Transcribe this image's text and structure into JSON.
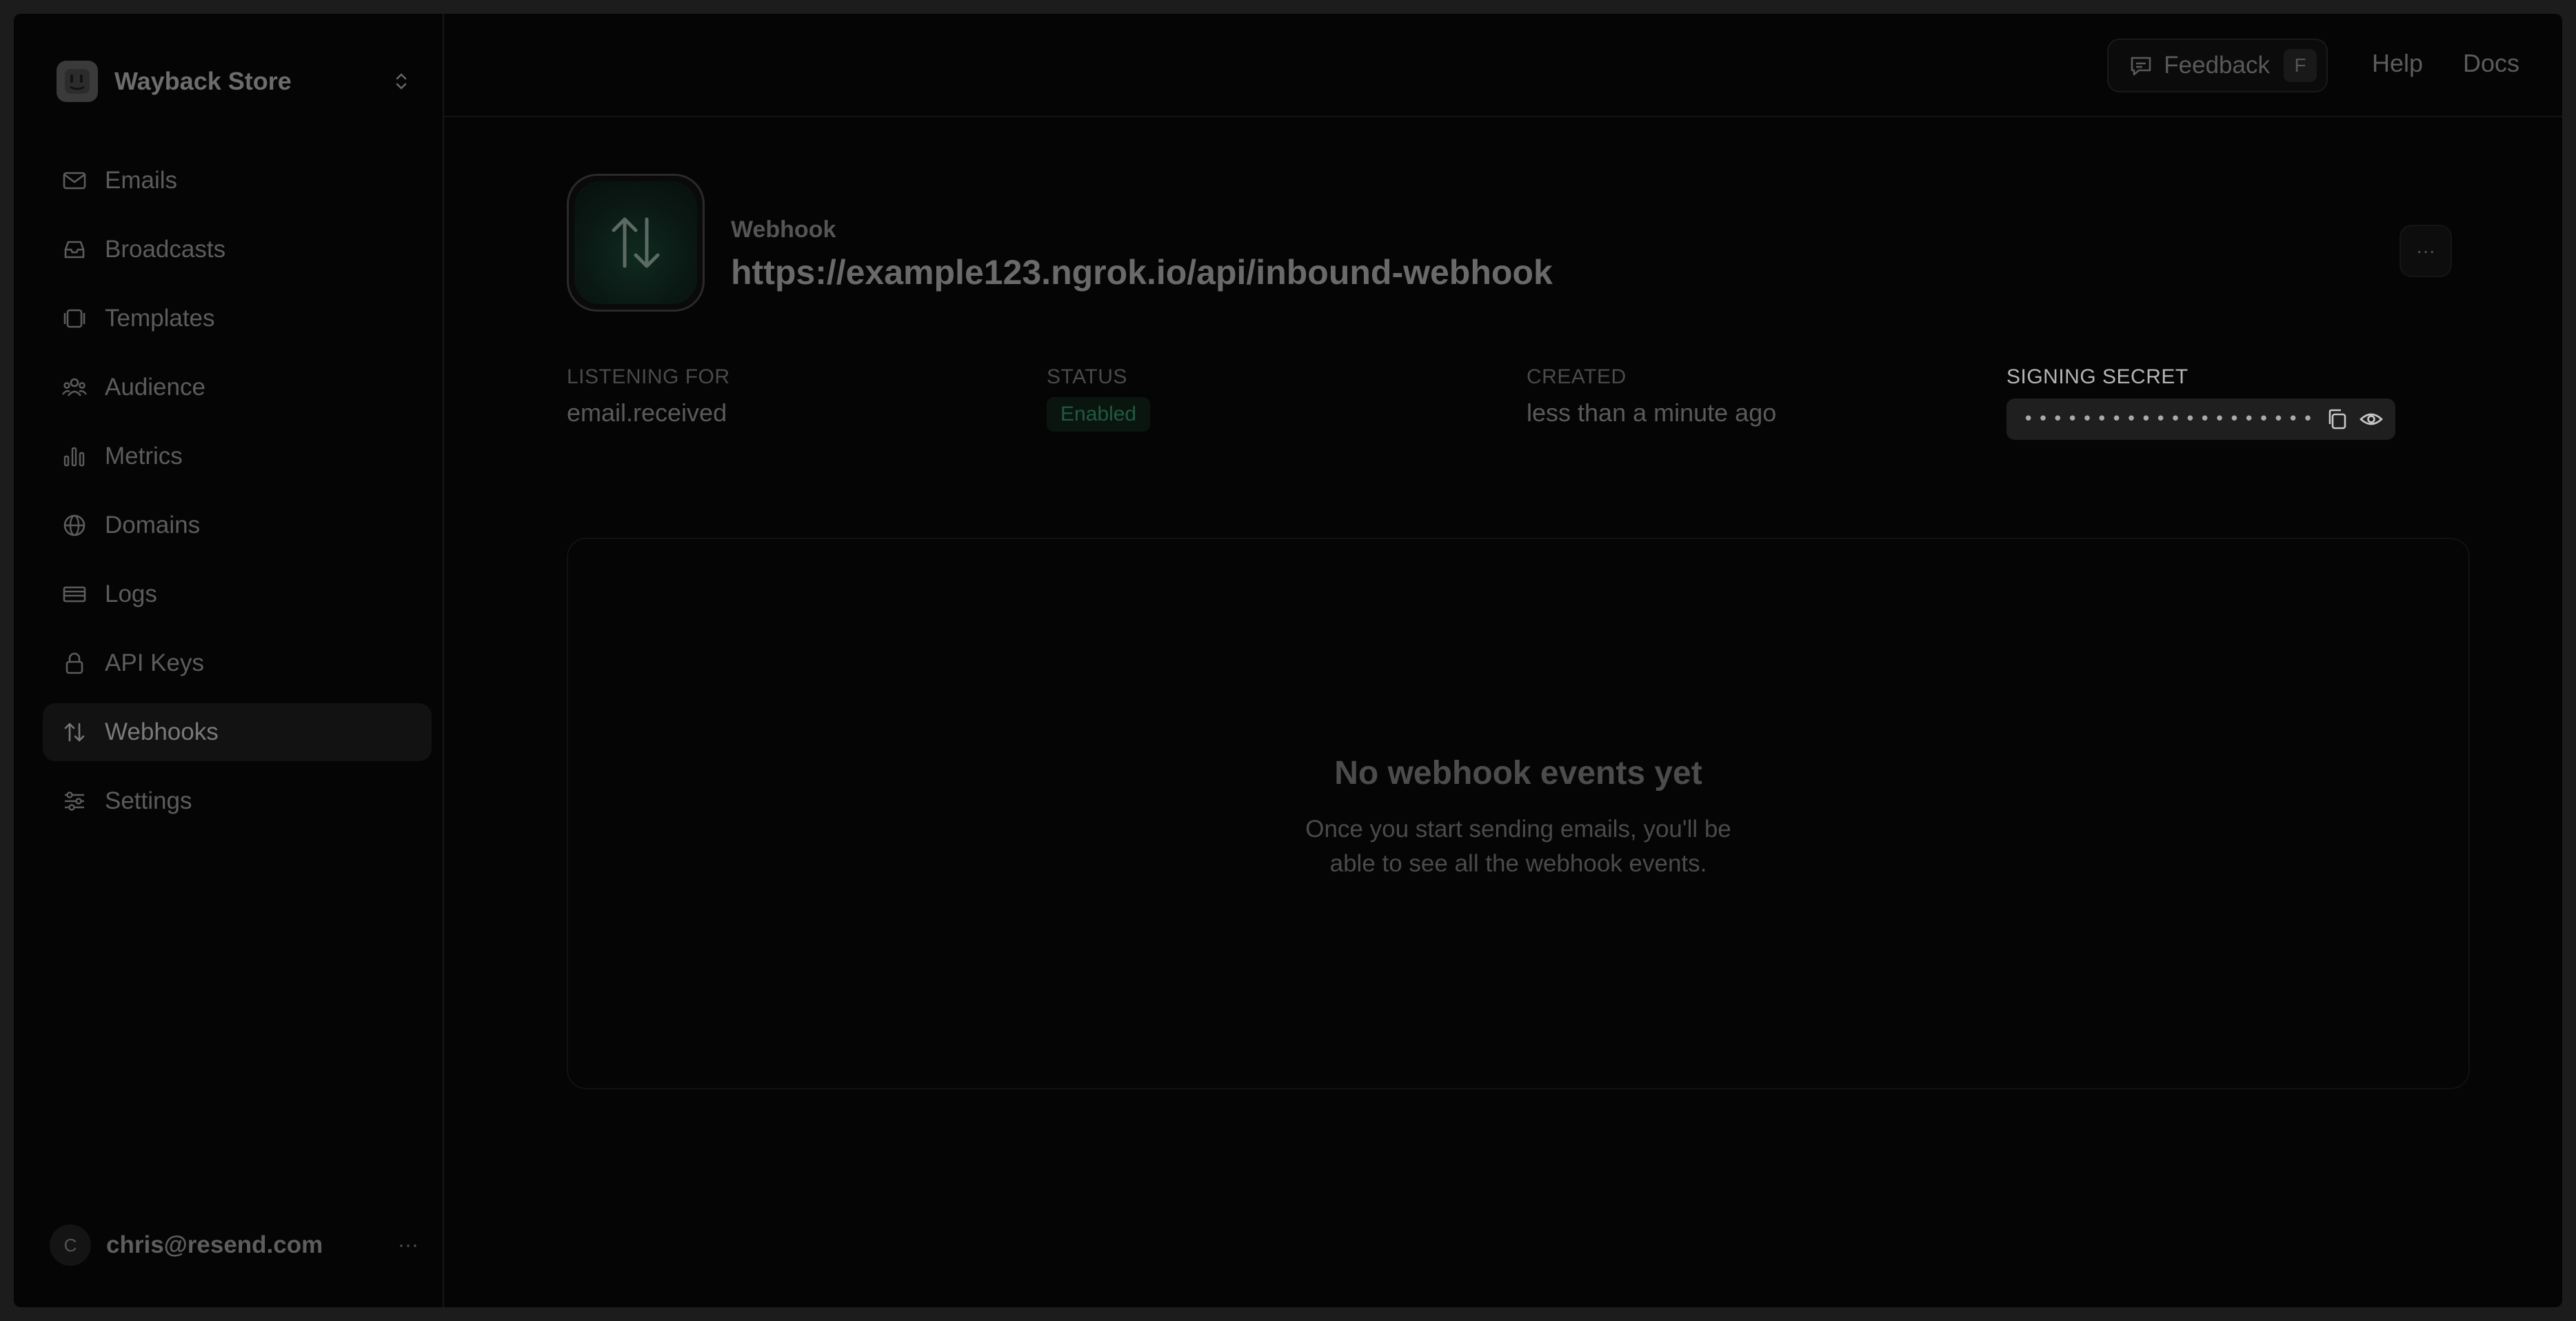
{
  "workspace": {
    "name": "Wayback Store"
  },
  "sidebar": {
    "items": [
      {
        "label": "Emails",
        "icon": "mail-icon",
        "active": false
      },
      {
        "label": "Broadcasts",
        "icon": "inbox-icon",
        "active": false
      },
      {
        "label": "Templates",
        "icon": "templates-icon",
        "active": false
      },
      {
        "label": "Audience",
        "icon": "users-icon",
        "active": false
      },
      {
        "label": "Metrics",
        "icon": "bar-chart-icon",
        "active": false
      },
      {
        "label": "Domains",
        "icon": "globe-icon",
        "active": false
      },
      {
        "label": "Logs",
        "icon": "logs-icon",
        "active": false
      },
      {
        "label": "API Keys",
        "icon": "lock-icon",
        "active": false
      },
      {
        "label": "Webhooks",
        "icon": "arrows-up-down-icon",
        "active": true
      },
      {
        "label": "Settings",
        "icon": "sliders-icon",
        "active": false
      }
    ]
  },
  "user": {
    "initial": "C",
    "email": "chris@resend.com",
    "more": "···"
  },
  "topbar": {
    "feedback_label": "Feedback",
    "feedback_shortcut": "F",
    "help_label": "Help",
    "docs_label": "Docs"
  },
  "webhook": {
    "kind": "Webhook",
    "url": "https://example123.ngrok.io/api/inbound-webhook",
    "more": "···",
    "listening_for_label": "LISTENING FOR",
    "listening_for_value": "email.received",
    "status_label": "STATUS",
    "status_value": "Enabled",
    "created_label": "CREATED",
    "created_value": "less than a minute ago",
    "secret_label": "SIGNING SECRET",
    "secret_value": "••••••••••••••••••••"
  },
  "events": {
    "empty_title": "No webhook events yet",
    "empty_desc": "Once you start sending emails, you'll be able to see all the webhook events."
  },
  "colors": {
    "background": "#050505",
    "status_green": "#1f5a40",
    "accent_icon_bg": "#0f2a20"
  }
}
